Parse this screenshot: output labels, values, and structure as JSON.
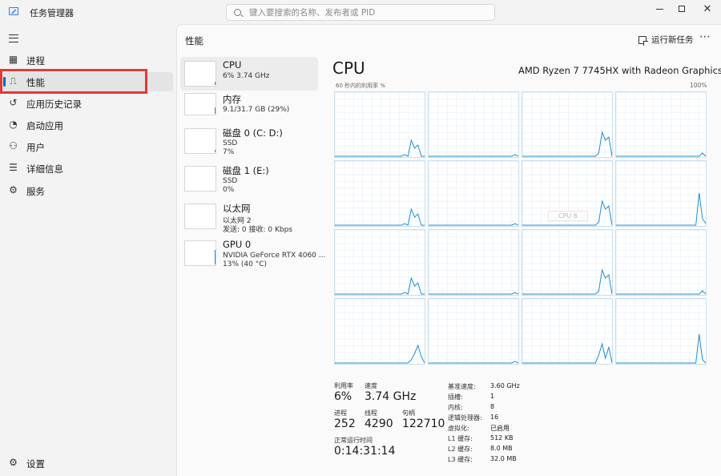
{
  "window": {
    "title": "任务管理器",
    "search_placeholder": "键入要搜索的名称、发布者或 PID",
    "minimize": "–",
    "maximize": "□",
    "close": "✕"
  },
  "nav": [
    {
      "label": "进程",
      "icon": "processes-icon"
    },
    {
      "label": "性能",
      "icon": "performance-icon",
      "active": true
    },
    {
      "label": "应用历史记录",
      "icon": "app-history-icon"
    },
    {
      "label": "启动应用",
      "icon": "startup-apps-icon"
    },
    {
      "label": "用户",
      "icon": "users-icon"
    },
    {
      "label": "详细信息",
      "icon": "details-icon"
    },
    {
      "label": "服务",
      "icon": "services-icon"
    }
  ],
  "settings_label": "设置",
  "header": {
    "title": "性能",
    "run_new_task": "运行新任务",
    "more": "⋯"
  },
  "devices": [
    {
      "name": "CPU",
      "sub1": "6% 3.74 GHz",
      "sub2": ""
    },
    {
      "name": "内存",
      "sub1": "9.1/31.7 GB (29%)",
      "sub2": ""
    },
    {
      "name": "磁盘 0 (C: D:)",
      "sub1": "SSD",
      "sub2": "7%"
    },
    {
      "name": "磁盘 1 (E:)",
      "sub1": "SSD",
      "sub2": "0%"
    },
    {
      "name": "以太网",
      "sub1": "以太网 2",
      "sub2": "发送: 0 接收: 0 Kbps"
    },
    {
      "name": "GPU 0",
      "sub1": "NVIDIA GeForce RTX 4060 ...",
      "sub2": "13% (40 °C)"
    }
  ],
  "cpu": {
    "title": "CPU",
    "model": "AMD Ryzen 7 7745HX with Radeon Graphics",
    "axis_label": "60 秒内的利用率 %",
    "axis_max": "100%",
    "grid_tooltip": "CPU 6",
    "colors": {
      "line": "#1c8fd4",
      "cell_border": "#c9dfef",
      "accent": "#0067c0",
      "highlight": "#e53935"
    }
  },
  "stats": {
    "utilization_label": "利用率",
    "utilization": "6%",
    "speed_label": "速度",
    "speed": "3.74 GHz",
    "processes_label": "进程",
    "processes": "252",
    "threads_label": "线程",
    "threads": "4290",
    "handles_label": "句柄",
    "handles": "122710",
    "uptime_label": "正常运行时间",
    "uptime": "0:14:31:14"
  },
  "specs": [
    {
      "label": "基准速度:",
      "value": "3.60 GHz"
    },
    {
      "label": "插槽:",
      "value": "1"
    },
    {
      "label": "内核:",
      "value": "8"
    },
    {
      "label": "逻辑处理器:",
      "value": "16"
    },
    {
      "label": "虚拟化:",
      "value": "已启用"
    },
    {
      "label": "L1 缓存:",
      "value": "512 KB"
    },
    {
      "label": "L2 缓存:",
      "value": "8.0 MB"
    },
    {
      "label": "L3 缓存:",
      "value": "32.0 MB"
    }
  ]
}
